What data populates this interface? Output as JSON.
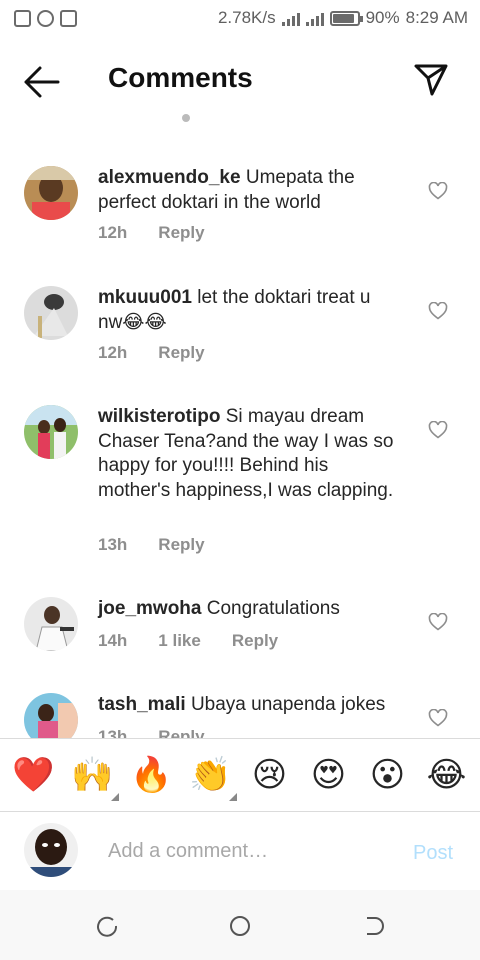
{
  "status_bar": {
    "speed": "2.78K/s",
    "battery": "90%",
    "time": "8:29 AM",
    "battery_level": 0.9
  },
  "header": {
    "title": "Comments"
  },
  "comments": [
    {
      "username": "alexmuendo_ke",
      "text": "Umepata the perfect doktari in the world",
      "time": "12h",
      "likes": "",
      "reply": "Reply"
    },
    {
      "username": "mkuuu001",
      "text": "let the doktari treat u nw😂😂",
      "time": "12h",
      "likes": "",
      "reply": "Reply"
    },
    {
      "username": "wilkisterotipo",
      "text": "Si mayau dream Chaser Tena?and the way I was so happy for you!!!! Behind his mother's happiness,I was clapping.",
      "time": "13h",
      "likes": "",
      "reply": "Reply"
    },
    {
      "username": "joe_mwoha",
      "text": "Congratulations",
      "time": "14h",
      "likes": "1 like",
      "reply": "Reply"
    },
    {
      "username": "tash_mali",
      "text": "Ubaya unapenda jokes",
      "time": "13h",
      "likes": "",
      "reply": "Reply"
    }
  ],
  "emoji_bar": {
    "emojis": [
      "❤️",
      "🙌",
      "🔥",
      "👏",
      "😢",
      "😍",
      "😮",
      "😂"
    ]
  },
  "add_comment": {
    "placeholder": "Add a comment…",
    "post_label": "Post"
  },
  "colors": {
    "accent_disabled": "#b2dffc",
    "secondary_text": "#8e8e8e",
    "primary_text": "#262626"
  }
}
